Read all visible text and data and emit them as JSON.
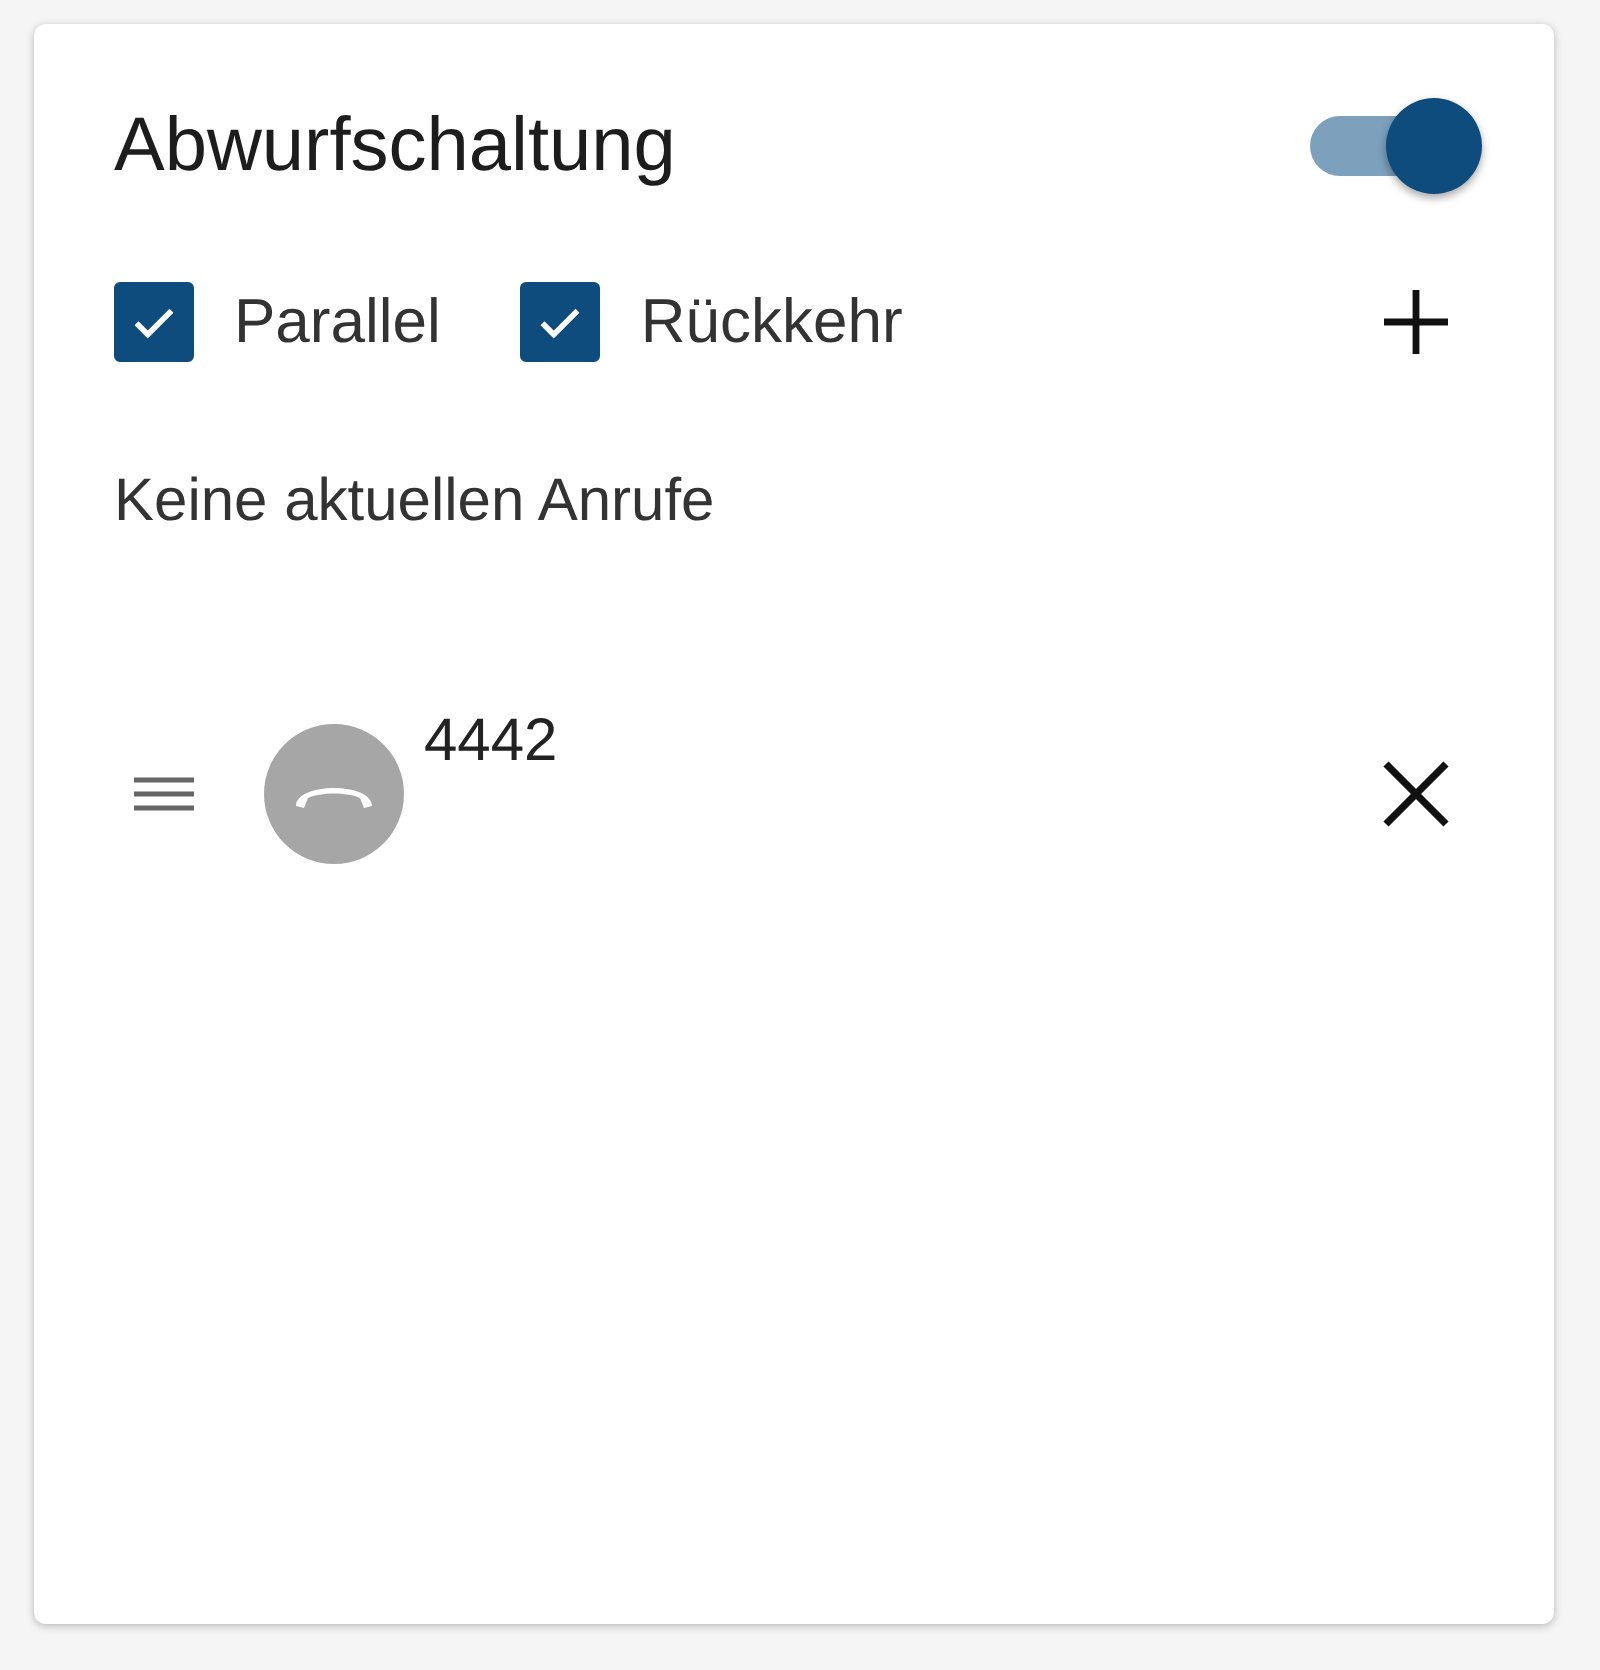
{
  "card": {
    "title": "Abwurfschaltung",
    "enabled": true,
    "options": [
      {
        "label": "Parallel",
        "checked": true
      },
      {
        "label": "Rückkehr",
        "checked": true
      }
    ],
    "empty_message": "Keine aktuellen Anrufe",
    "entries": [
      {
        "number": "4442"
      }
    ]
  }
}
